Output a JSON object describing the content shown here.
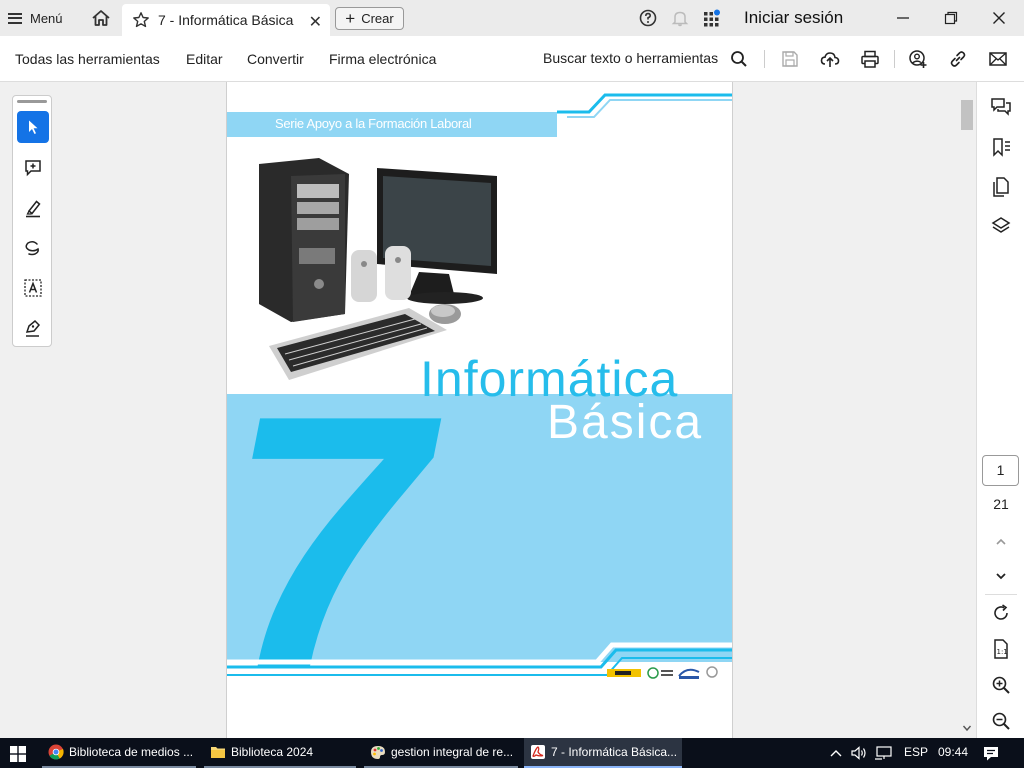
{
  "titlebar": {
    "menu_label": "Menú",
    "tab_title": "7 - Informática Básica",
    "create_label": "Crear",
    "signin_label": "Iniciar sesión"
  },
  "toolbar": {
    "items": [
      "Todas las herramientas",
      "Editar",
      "Convertir",
      "Firma electrónica"
    ],
    "search_label": "Buscar texto o herramientas"
  },
  "left_tools": [
    "select-tool",
    "add-comment-tool",
    "highlight-tool",
    "draw-tool",
    "text-select-tool",
    "sign-tool"
  ],
  "document": {
    "serie": "Serie Apoyo a la Formación Laboral",
    "title_line1": "Informática",
    "title_line2": "Básica",
    "number": "7"
  },
  "navigation": {
    "current_page": "1",
    "total_pages": "21"
  },
  "taskbar": {
    "tasks": [
      {
        "label": "Biblioteca de medios ...",
        "icon": "chrome-icon"
      },
      {
        "label": "Biblioteca 2024",
        "icon": "folder-icon"
      },
      {
        "label": "gestion integral de re...",
        "icon": "paint-icon"
      },
      {
        "label": "7 - Informática Básica...",
        "icon": "acrobat-icon"
      }
    ],
    "language": "ESP",
    "time": "09:44"
  },
  "colors": {
    "accent": "#1473e6",
    "cover_light_blue": "#8fd6f4",
    "cover_blue": "#1bbcec",
    "taskbar": "#0a0f1a"
  }
}
